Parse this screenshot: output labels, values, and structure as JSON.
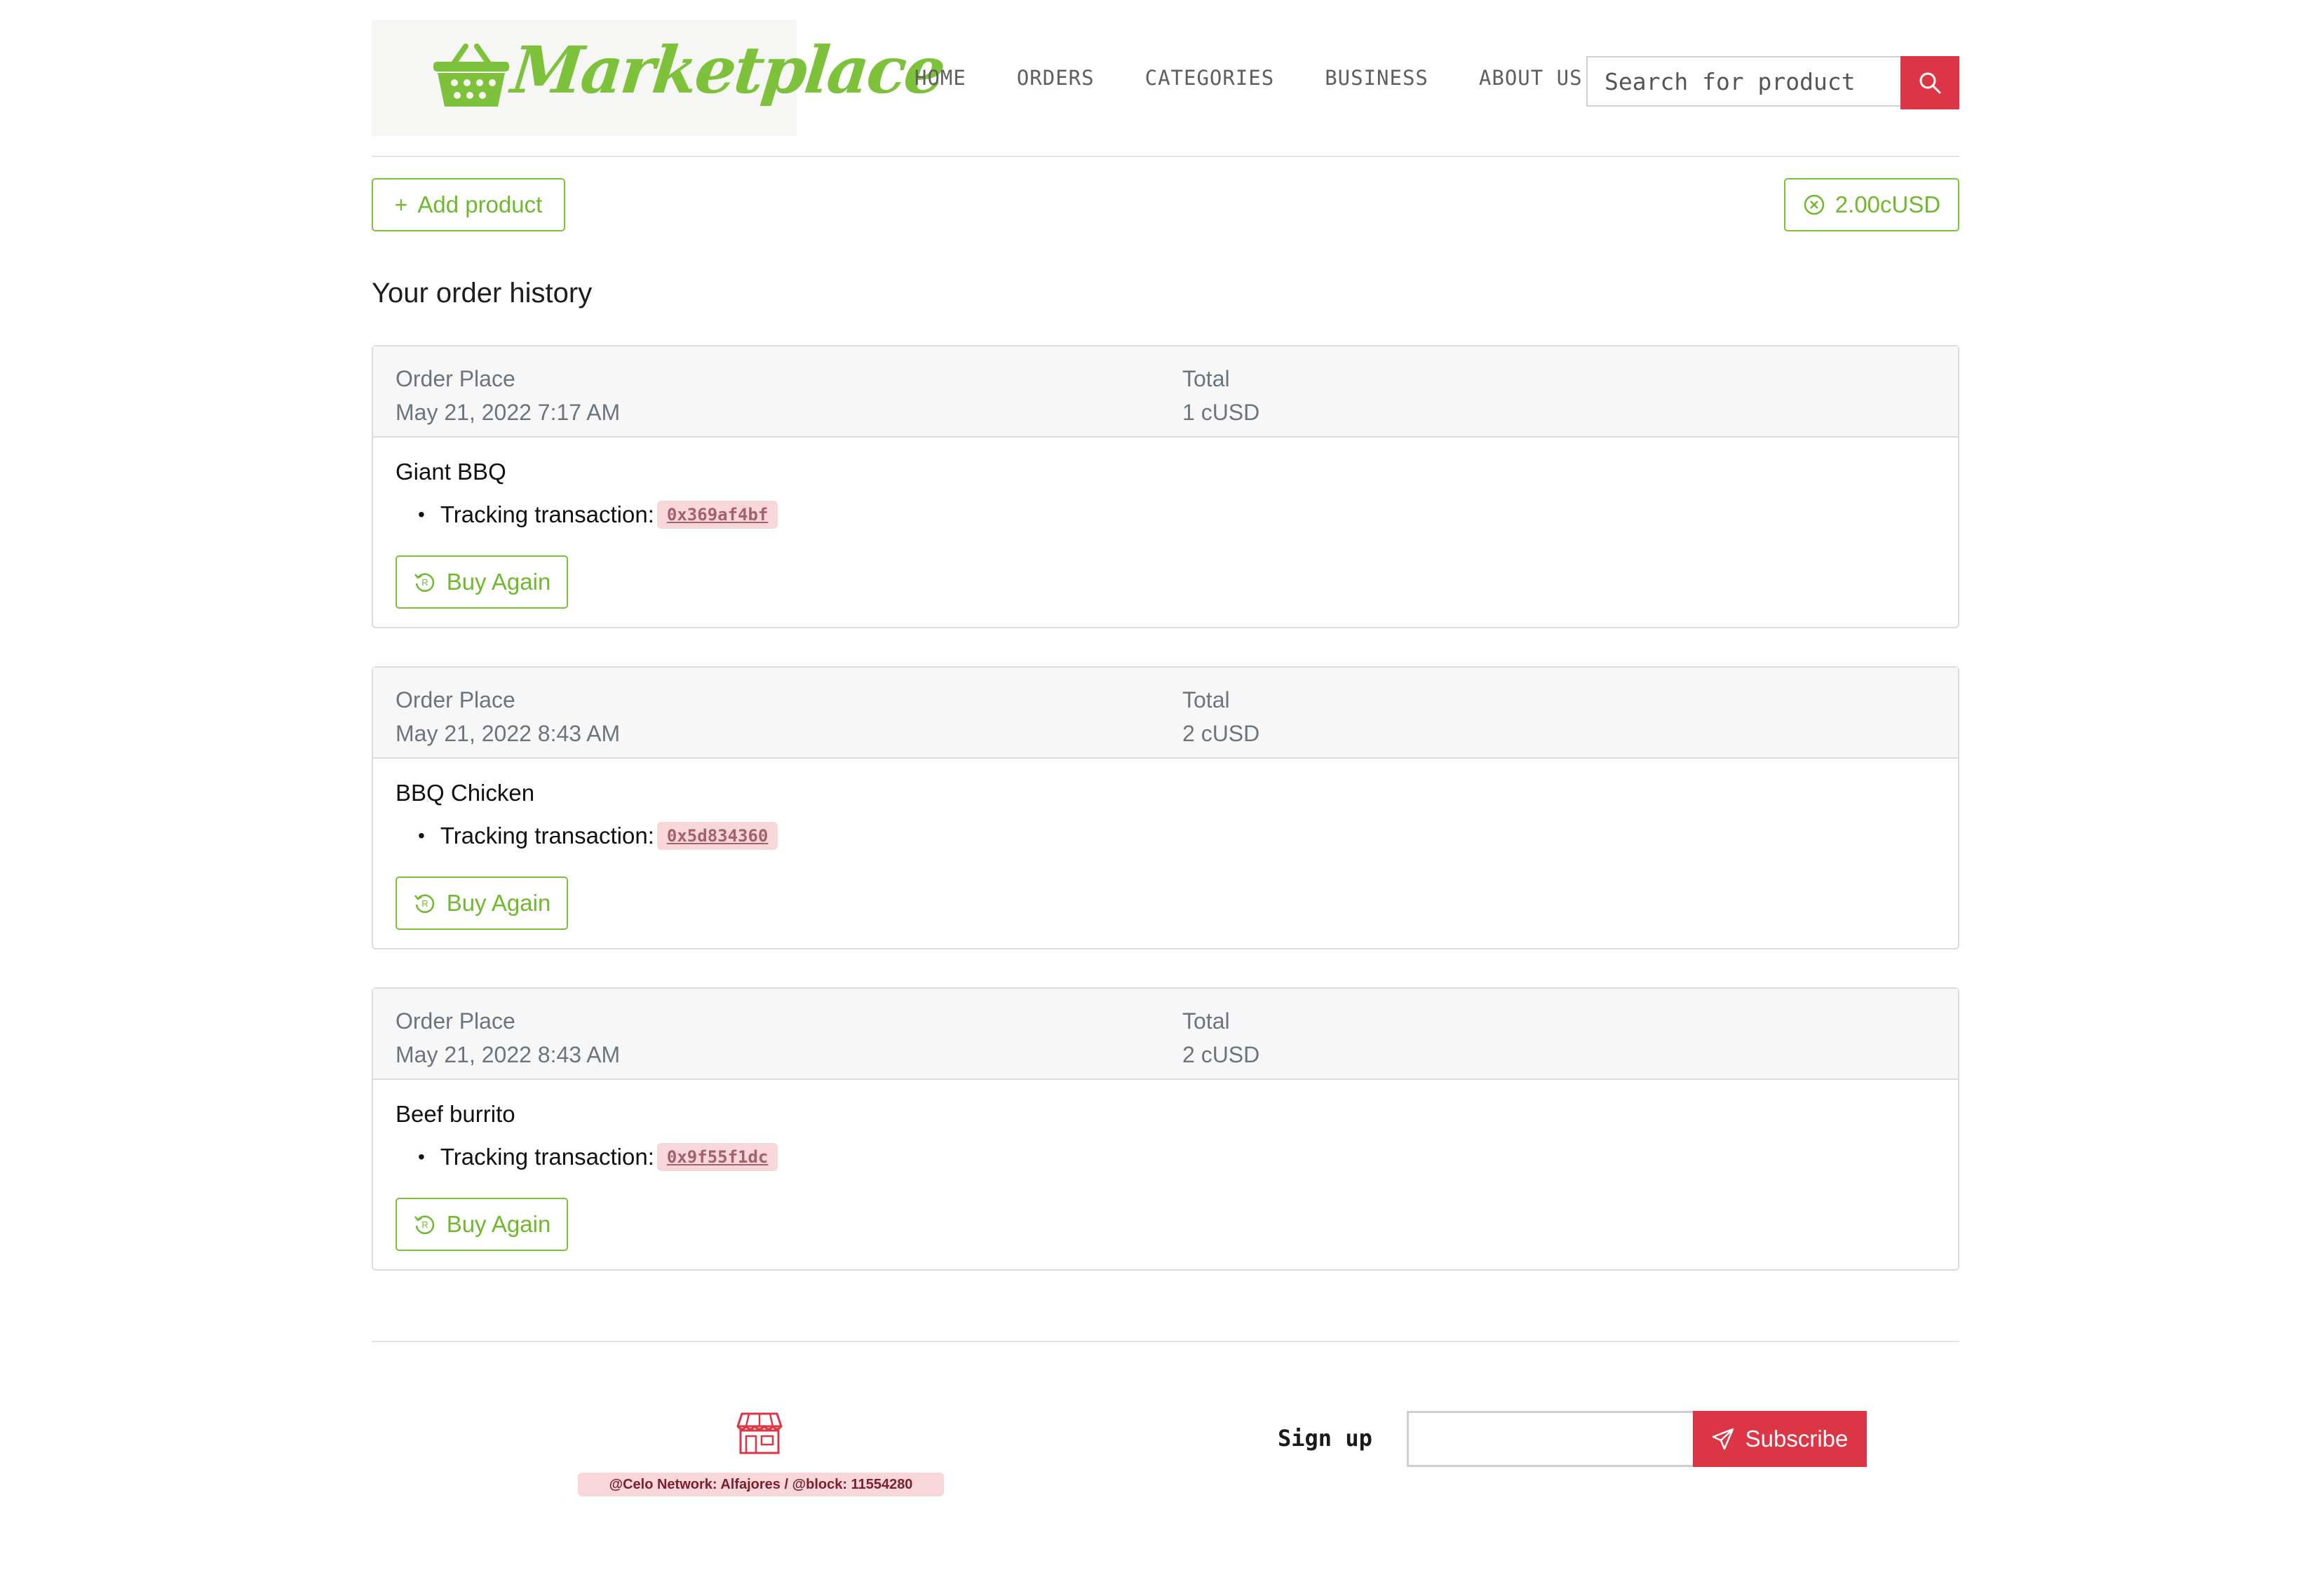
{
  "header": {
    "logo_text": "Marketplace",
    "nav": [
      "HOME",
      "ORDERS",
      "CATEGORIES",
      "BUSINESS",
      "ABOUT US"
    ],
    "search_placeholder": "Search for product",
    "search_icon": "search-icon"
  },
  "actions": {
    "add_product_label": "Add product",
    "balance_label": "2.00cUSD"
  },
  "history_title": "Your order history",
  "order_labels": {
    "place": "Order Place",
    "total": "Total",
    "tracking": "Tracking transaction:",
    "buy_again": "Buy Again"
  },
  "orders": [
    {
      "date": "May 21, 2022 7:17 AM",
      "total": "1 cUSD",
      "product": "Giant BBQ",
      "tx": "0x369af4bf"
    },
    {
      "date": "May 21, 2022 8:43 AM",
      "total": "2 cUSD",
      "product": "BBQ Chicken",
      "tx": "0x5d834360"
    },
    {
      "date": "May 21, 2022 8:43 AM",
      "total": "2 cUSD",
      "product": "Beef burrito",
      "tx": "0x9f55f1dc"
    }
  ],
  "footer": {
    "network_badge": "@Celo Network: Alfajores / @block: 11554280",
    "signup_label": "Sign up",
    "signup_value": "",
    "subscribe_label": "Subscribe"
  },
  "colors": {
    "brand_green": "#7ec13b",
    "danger_red": "#dc3545",
    "badge_pink": "#f8d7da"
  }
}
